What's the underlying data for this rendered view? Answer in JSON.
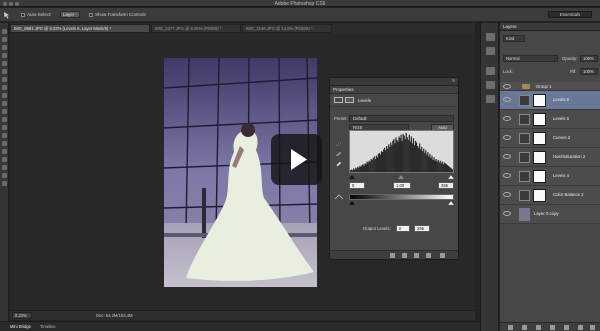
{
  "window": {
    "title": "Adobe Photoshop CS6"
  },
  "options_bar": {
    "auto_select_label": "Auto-Select:",
    "auto_select_value": "Layer",
    "transform_label": "Show Transform Controls",
    "workspace": "Essentials"
  },
  "tabs": [
    {
      "label": "IMG_8881.JPG @ 8.33% (Levels 6, Layer Mask/8) *",
      "active": true
    },
    {
      "label": "IMG_2277.JPG @ 6.25% (RGB/8) *",
      "active": false
    },
    {
      "label": "IMG_3146.JPG @ 13.8% (RGB/8) *",
      "active": false
    }
  ],
  "properties": {
    "panel_title": "Properties",
    "adjustment_name": "Levels",
    "preset_label": "Preset:",
    "preset_value": "Default",
    "channel": "RGB",
    "auto_label": "Auto",
    "input_levels": [
      "0",
      "1.00",
      "255"
    ],
    "output_label": "Output Levels:",
    "output_levels": [
      "0",
      "255"
    ],
    "histogram": [
      2,
      3,
      2,
      4,
      3,
      5,
      4,
      6,
      5,
      7,
      6,
      8,
      9,
      7,
      10,
      9,
      12,
      11,
      13,
      12,
      15,
      14,
      16,
      18,
      15,
      19,
      17,
      21,
      22,
      20,
      24,
      23,
      26,
      28,
      25,
      30,
      27,
      32,
      29,
      34,
      31,
      36,
      38,
      33,
      40,
      37,
      35,
      41,
      39,
      43,
      36,
      44,
      42,
      38,
      45,
      40,
      37,
      43,
      35,
      41,
      33,
      39,
      31,
      36,
      34,
      30,
      28,
      33,
      26,
      29,
      24,
      27,
      22,
      25,
      20,
      23,
      18,
      21,
      16,
      19,
      14,
      17,
      13,
      15,
      12,
      14,
      11,
      13,
      10,
      12,
      9,
      11,
      10,
      9,
      8,
      7,
      6,
      5,
      4,
      3
    ]
  },
  "layers": {
    "panel_title": "Layers",
    "kind_label": "Kind",
    "blend_mode": "Normal",
    "opacity_label": "Opacity:",
    "opacity_value": "100%",
    "lock_label": "Lock:",
    "fill_label": "Fill:",
    "fill_value": "100%",
    "group_name": "Group 1",
    "items": [
      {
        "name": "Levels 6",
        "selected": true
      },
      {
        "name": "Levels 5",
        "selected": false
      },
      {
        "name": "Curves 2",
        "selected": false
      },
      {
        "name": "Hue/Saturation 2",
        "selected": false
      },
      {
        "name": "Levels 4",
        "selected": false
      },
      {
        "name": "Color Balance 2",
        "selected": false
      },
      {
        "name": "Layer 0 copy",
        "selected": false
      }
    ]
  },
  "status": {
    "zoom": "8.33%",
    "doc": "Doc: 64.2M/153.4M"
  },
  "bottom_tabs": [
    "Mini Bridge",
    "Timeline"
  ],
  "colors": {
    "selection": "#6a7897",
    "panel": "#474747",
    "canvas": "#282828"
  }
}
